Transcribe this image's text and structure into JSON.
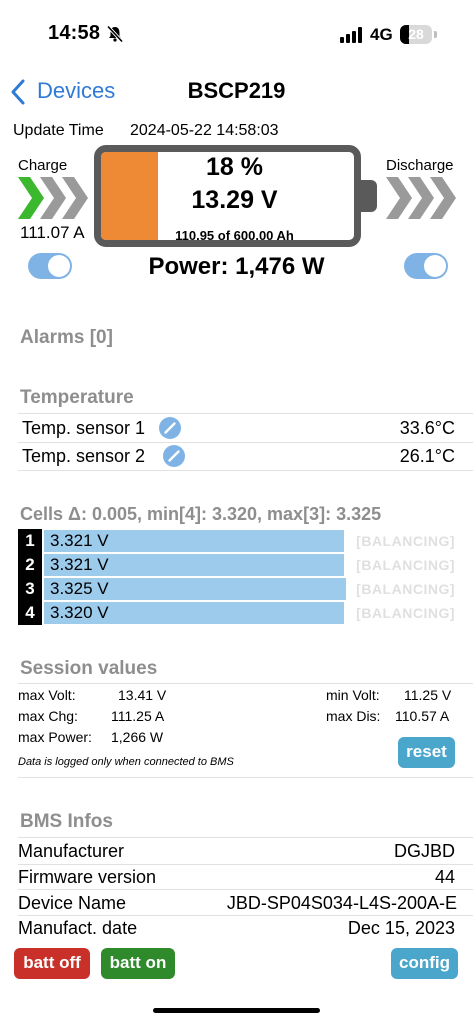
{
  "status_bar": {
    "time": "14:58",
    "network": "4G",
    "battery": "28"
  },
  "nav": {
    "back_label": "Devices",
    "title": "BSCP219"
  },
  "update": {
    "label": "Update Time",
    "value": "2024-05-22 14:58:03"
  },
  "battery": {
    "charge_label": "Charge",
    "discharge_label": "Discharge",
    "charge_current": "111.07 A",
    "soc_text": "18 %",
    "soc_fraction": 0.18,
    "voltage": "13.29 V",
    "capacity": "110.95 of 600.00 Ah",
    "power": "Power: 1,476 W",
    "charge_enabled": true,
    "discharge_enabled": true,
    "fill_color": "#ee8a36",
    "charge_arrow_color": "#3cb82e",
    "arrow_color": "#9a9a9a"
  },
  "alarms": {
    "title": "Alarms [0]"
  },
  "temperature": {
    "title": "Temperature",
    "sensors": [
      {
        "label": "Temp. sensor 1",
        "value": "33.6°C"
      },
      {
        "label": "Temp. sensor 2",
        "value": "26.1°C"
      }
    ]
  },
  "cells": {
    "title": "Cells Δ: 0.005, min[4]: 3.320, max[3]: 3.325",
    "rows": [
      {
        "index": "1",
        "voltage": "3.321 V",
        "level": 3.321,
        "status": "[BALANCING]"
      },
      {
        "index": "2",
        "voltage": "3.321 V",
        "level": 3.321,
        "status": "[BALANCING]"
      },
      {
        "index": "3",
        "voltage": "3.325 V",
        "level": 3.325,
        "status": "[BALANCING]"
      },
      {
        "index": "4",
        "voltage": "3.320 V",
        "level": 3.32,
        "status": "[BALANCING]"
      }
    ],
    "bar_color": "#9ccbeb"
  },
  "session": {
    "title": "Session values",
    "max_volt_label": "max Volt:",
    "max_volt": "13.41 V",
    "max_chg_label": "max Chg:",
    "max_chg": "111.25 A",
    "max_power_label": "max Power:",
    "max_power": "1,266 W",
    "min_volt_label": "min Volt:",
    "min_volt": "11.25 V",
    "max_dis_label": "max Dis:",
    "max_dis": "110.57 A",
    "note": "Data is logged only when connected to BMS",
    "reset_label": "reset"
  },
  "bms": {
    "title": "BMS Infos",
    "rows": [
      {
        "label": "Manufacturer",
        "value": "DGJBD"
      },
      {
        "label": "Firmware version",
        "value": "44"
      },
      {
        "label": "Device Name",
        "value": "JBD-SP04S034-L4S-200A-E"
      },
      {
        "label": "Manufact. date",
        "value": "Dec 15, 2023"
      }
    ]
  },
  "actions": {
    "batt_off": "batt off",
    "batt_on": "batt on",
    "config": "config"
  }
}
